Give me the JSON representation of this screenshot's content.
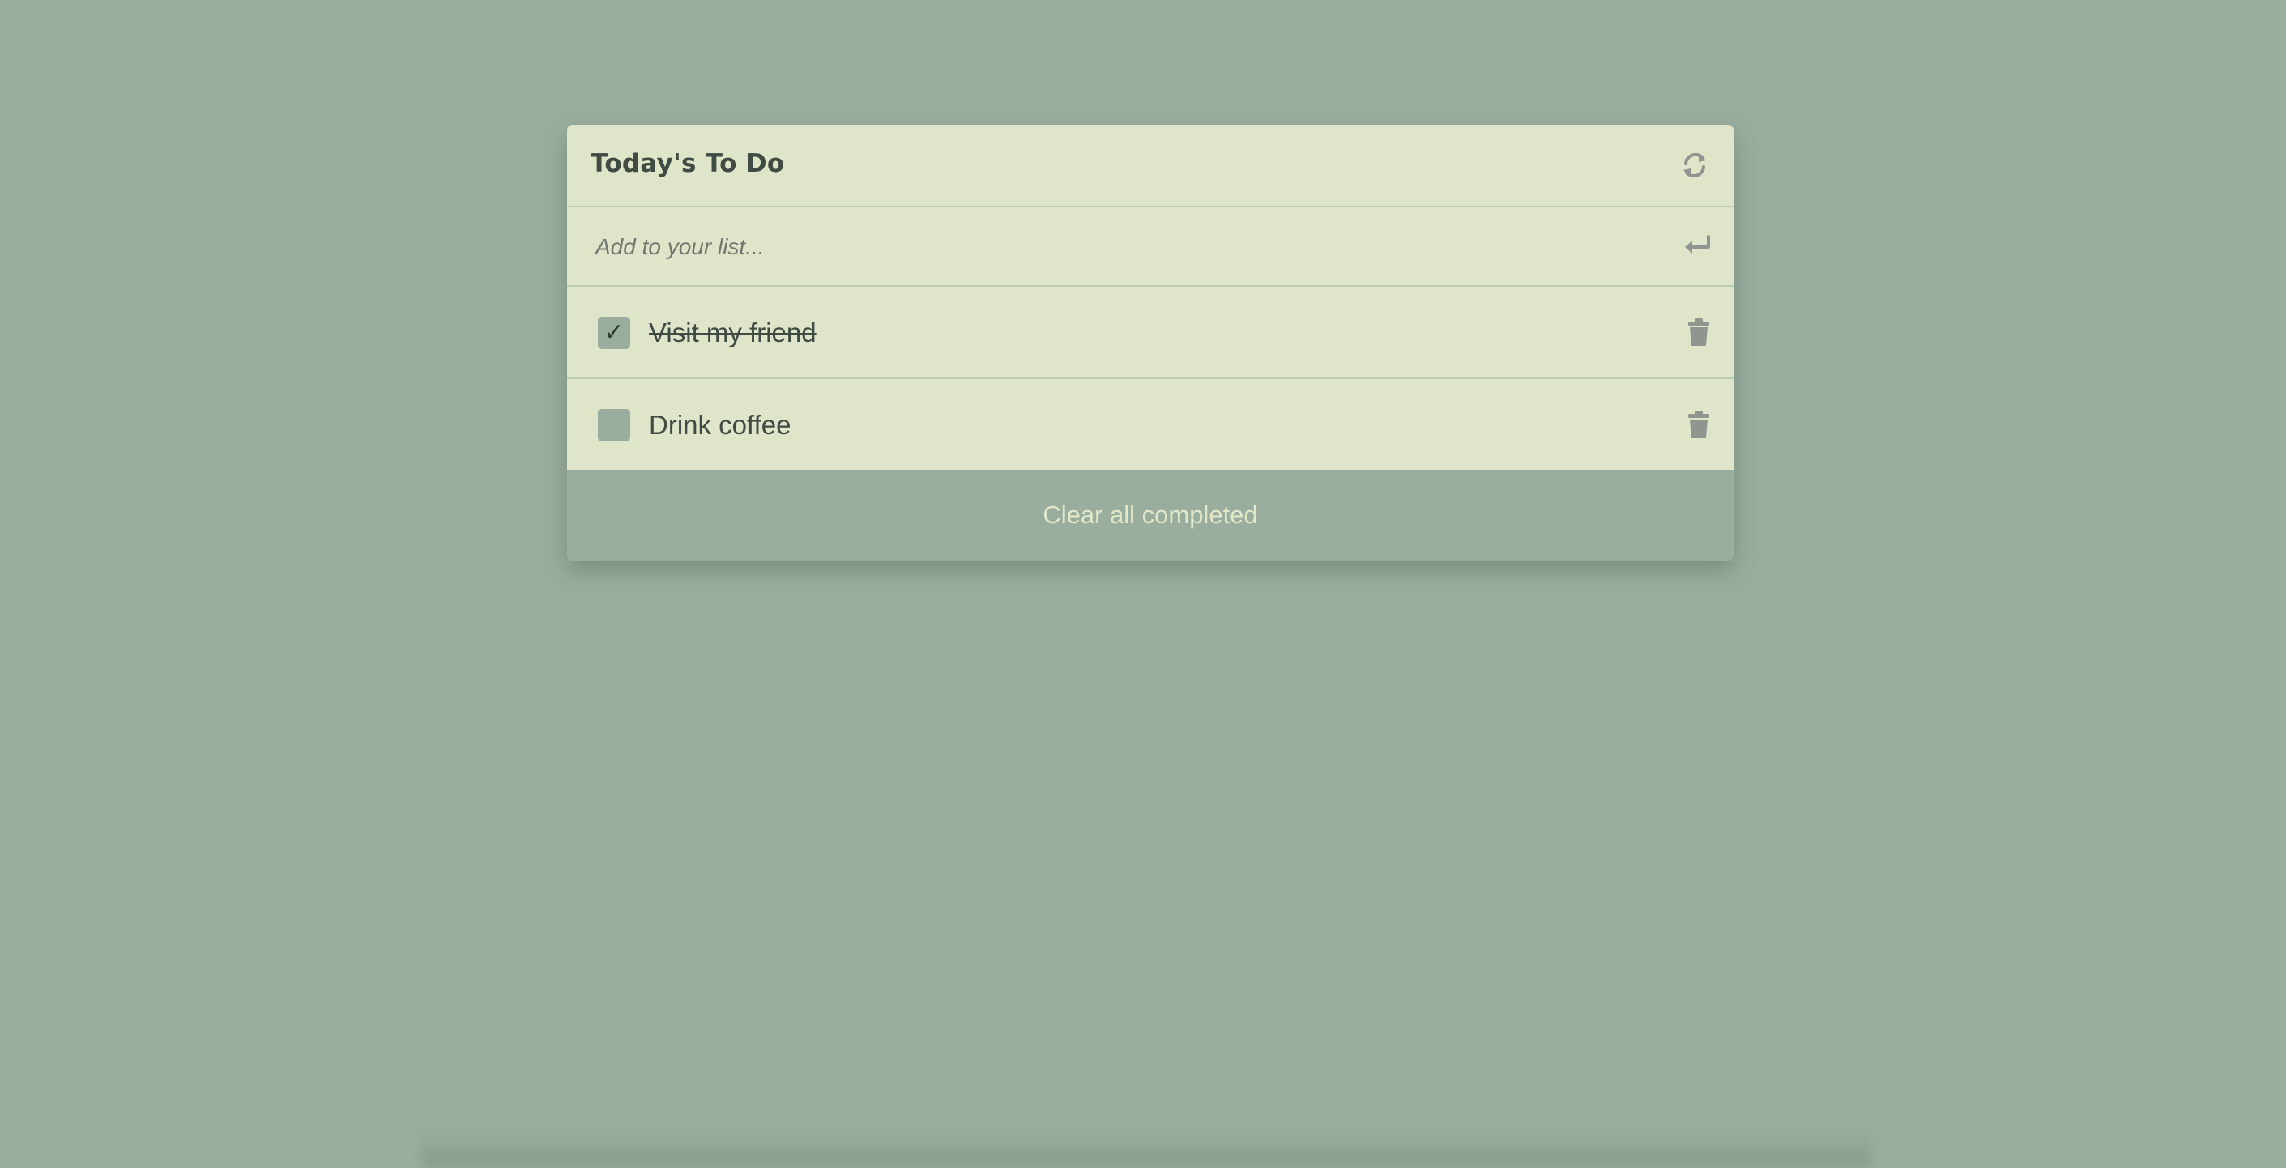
{
  "app": {
    "title": "Today's To Do"
  },
  "add": {
    "placeholder": "Add to your list...",
    "value": ""
  },
  "icons": {
    "refresh": "refresh-icon",
    "enter": "enter-icon",
    "trash": "trash-icon",
    "check": "check-icon"
  },
  "todos": [
    {
      "text": "Visit my friend",
      "completed": true
    },
    {
      "text": "Drink coffee",
      "completed": false
    }
  ],
  "footer": {
    "clear_label": "Clear all completed"
  },
  "colors": {
    "background": "#99ae9f",
    "card": "#dfe5c9",
    "divider": "#bccdb3",
    "text": "#3f4b43",
    "icon": "#8f958f",
    "footer_text": "#e3e8c8"
  }
}
